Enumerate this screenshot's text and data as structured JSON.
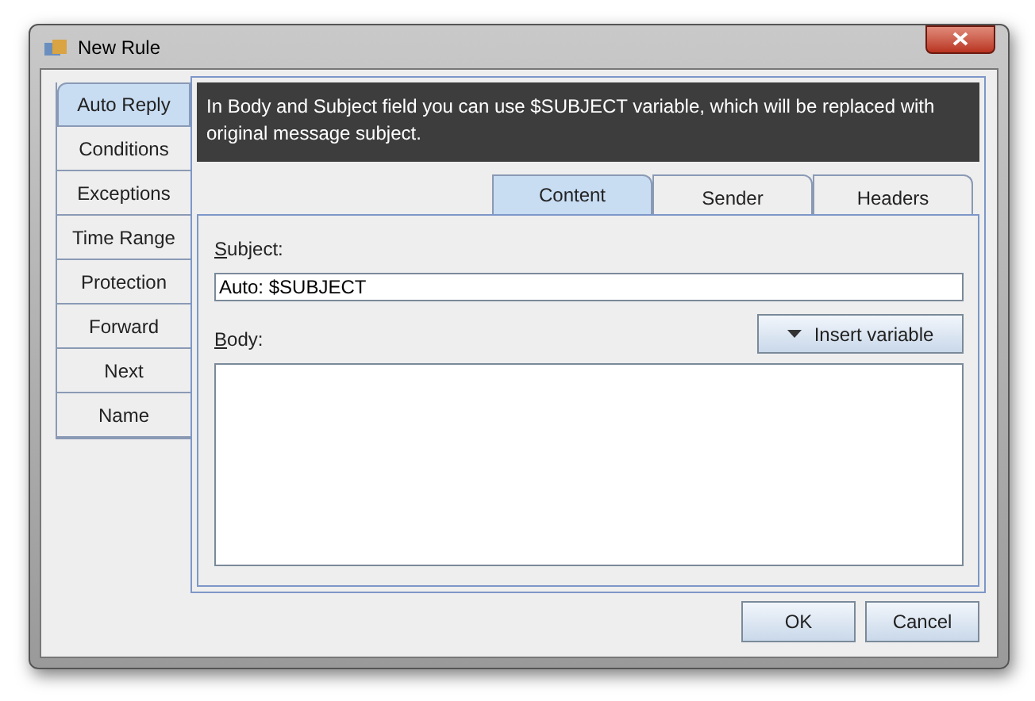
{
  "window": {
    "title": "New Rule"
  },
  "side_tabs": [
    {
      "label": "Auto Reply",
      "selected": true
    },
    {
      "label": "Conditions",
      "selected": false
    },
    {
      "label": "Exceptions",
      "selected": false
    },
    {
      "label": "Time Range",
      "selected": false
    },
    {
      "label": "Protection",
      "selected": false
    },
    {
      "label": "Forward",
      "selected": false
    },
    {
      "label": "Next",
      "selected": false
    },
    {
      "label": "Name",
      "selected": false
    }
  ],
  "info": "In Body and Subject field you can use $SUBJECT variable, which will be replaced with original message subject.",
  "tabs": [
    {
      "label": "Content",
      "selected": true
    },
    {
      "label": "Sender",
      "selected": false
    },
    {
      "label": "Headers",
      "selected": false
    }
  ],
  "subject": {
    "label": "Subject:",
    "value": "Auto: $SUBJECT"
  },
  "body": {
    "label": "Body:"
  },
  "insert_button": "Insert variable",
  "buttons": [
    "OK",
    "Cancel"
  ]
}
